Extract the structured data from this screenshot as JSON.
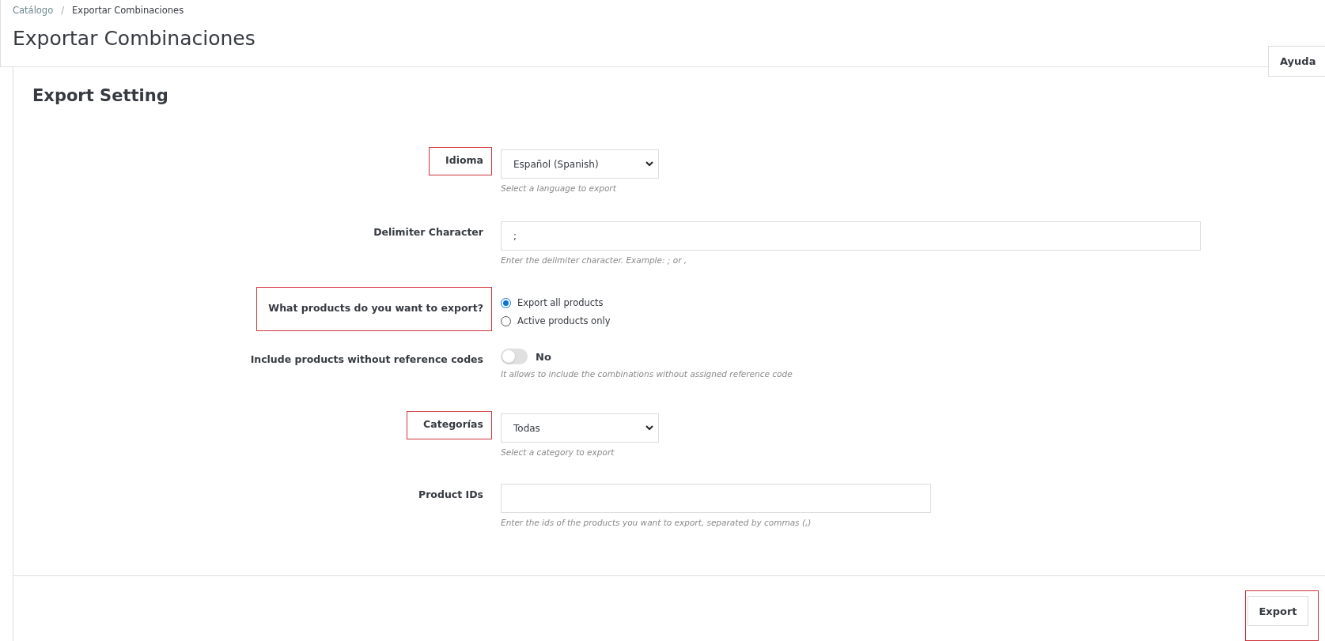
{
  "breadcrumb": [
    {
      "label": "Catálogo",
      "current": false
    },
    {
      "label": "Exportar Combinaciones",
      "current": true
    }
  ],
  "breadcrumb_separator": "/",
  "page_title": "Exportar Combinaciones",
  "help_button": {
    "label": "Ayuda"
  },
  "panel": {
    "title": "Export Setting",
    "fields": [
      {
        "kind": "select",
        "label": "Idioma",
        "highlighted": true,
        "value": "Español (Spanish)",
        "help": "Select a language to export"
      },
      {
        "kind": "widetext",
        "label": "Delimiter Character",
        "highlighted": false,
        "value": ";",
        "help": "Enter the delimiter character. Example: ; or ,"
      },
      {
        "kind": "radio",
        "label": "What products do you want to export?",
        "highlighted": true,
        "options": [
          {
            "label": "Export all products",
            "selected": true
          },
          {
            "label": "Active products only",
            "selected": false
          }
        ]
      },
      {
        "kind": "switch",
        "label": "Include products without reference codes",
        "highlighted": false,
        "on": false,
        "state_label": "No",
        "help": "It allows to include the combinations without assigned reference code"
      },
      {
        "kind": "select",
        "label": "Categorías",
        "highlighted": true,
        "value": "Todas",
        "help": "Select a category to export"
      },
      {
        "kind": "text",
        "label": "Product IDs",
        "highlighted": false,
        "help": "Enter the ids of the products you want to export, separated by commas (,)"
      }
    ],
    "export_button": {
      "label": "Export",
      "highlighted": true
    }
  }
}
